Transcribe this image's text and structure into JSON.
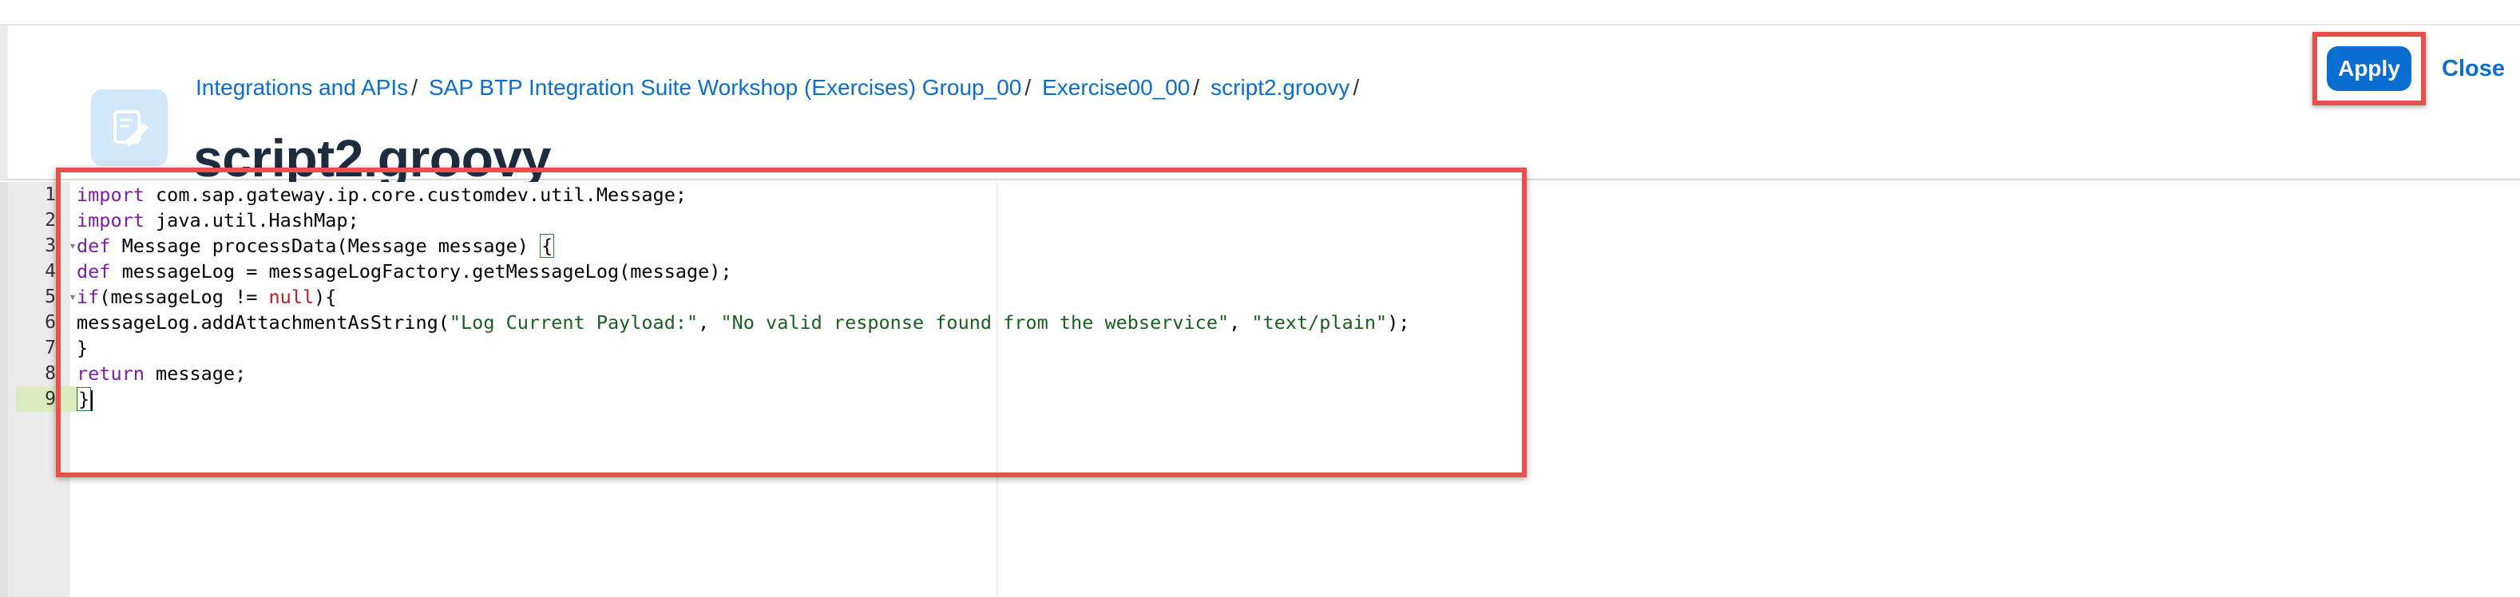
{
  "breadcrumb": {
    "items": [
      "Integrations and APIs",
      "SAP BTP Integration Suite Workshop (Exercises) Group_00",
      "Exercise00_00",
      "script2.groovy"
    ],
    "separator": "/"
  },
  "page": {
    "title": "script2.groovy"
  },
  "actions": {
    "apply_label": "Apply",
    "close_label": "Close"
  },
  "editor": {
    "line_numbers": [
      "1",
      "2",
      "3",
      "4",
      "5",
      "6",
      "7",
      "8",
      "9"
    ],
    "active_line": 9,
    "lines": [
      "import com.sap.gateway.ip.core.customdev.util.Message;",
      "import java.util.HashMap;",
      "def Message processData(Message message) {",
      "def messageLog = messageLogFactory.getMessageLog(message);",
      "if(messageLog != null){",
      "messageLog.addAttachmentAsString(\"Log Current Payload:\", \"No valid response found from the webservice\", \"text/plain\");",
      "}",
      "return message;",
      "}"
    ],
    "tokens": {
      "l1_kw": "import",
      "l1_rest": " com.sap.gateway.ip.core.customdev.util.Message;",
      "l2_kw": "import",
      "l2_rest": " java.util.HashMap;",
      "l3_kw": "def",
      "l3_rest": " Message processData(Message message) ",
      "l3_brace": "{",
      "l4_kw": "def",
      "l4_rest": " messageLog = messageLogFactory.getMessageLog(message);",
      "l5_kw": "if",
      "l5_a": "(messageLog != ",
      "l5_null": "null",
      "l5_b": "){",
      "l6_a": "messageLog.addAttachmentAsString(",
      "l6_s1": "\"Log Current Payload:\"",
      "l6_c1": ", ",
      "l6_s2": "\"No valid response found from the webservice\"",
      "l6_c2": ", ",
      "l6_s3": "\"text/plain\"",
      "l6_end": ");",
      "l7": "}",
      "l8_kw": "return",
      "l8_rest": " message;",
      "l9_brace": "}"
    }
  },
  "colors": {
    "link": "#0a6ed1",
    "apply_bg": "#0a6ed1",
    "annotation_border": "#e8504b",
    "keyword": "#7a1fa2",
    "string": "#1a5e20",
    "null_literal": "#b22222"
  }
}
